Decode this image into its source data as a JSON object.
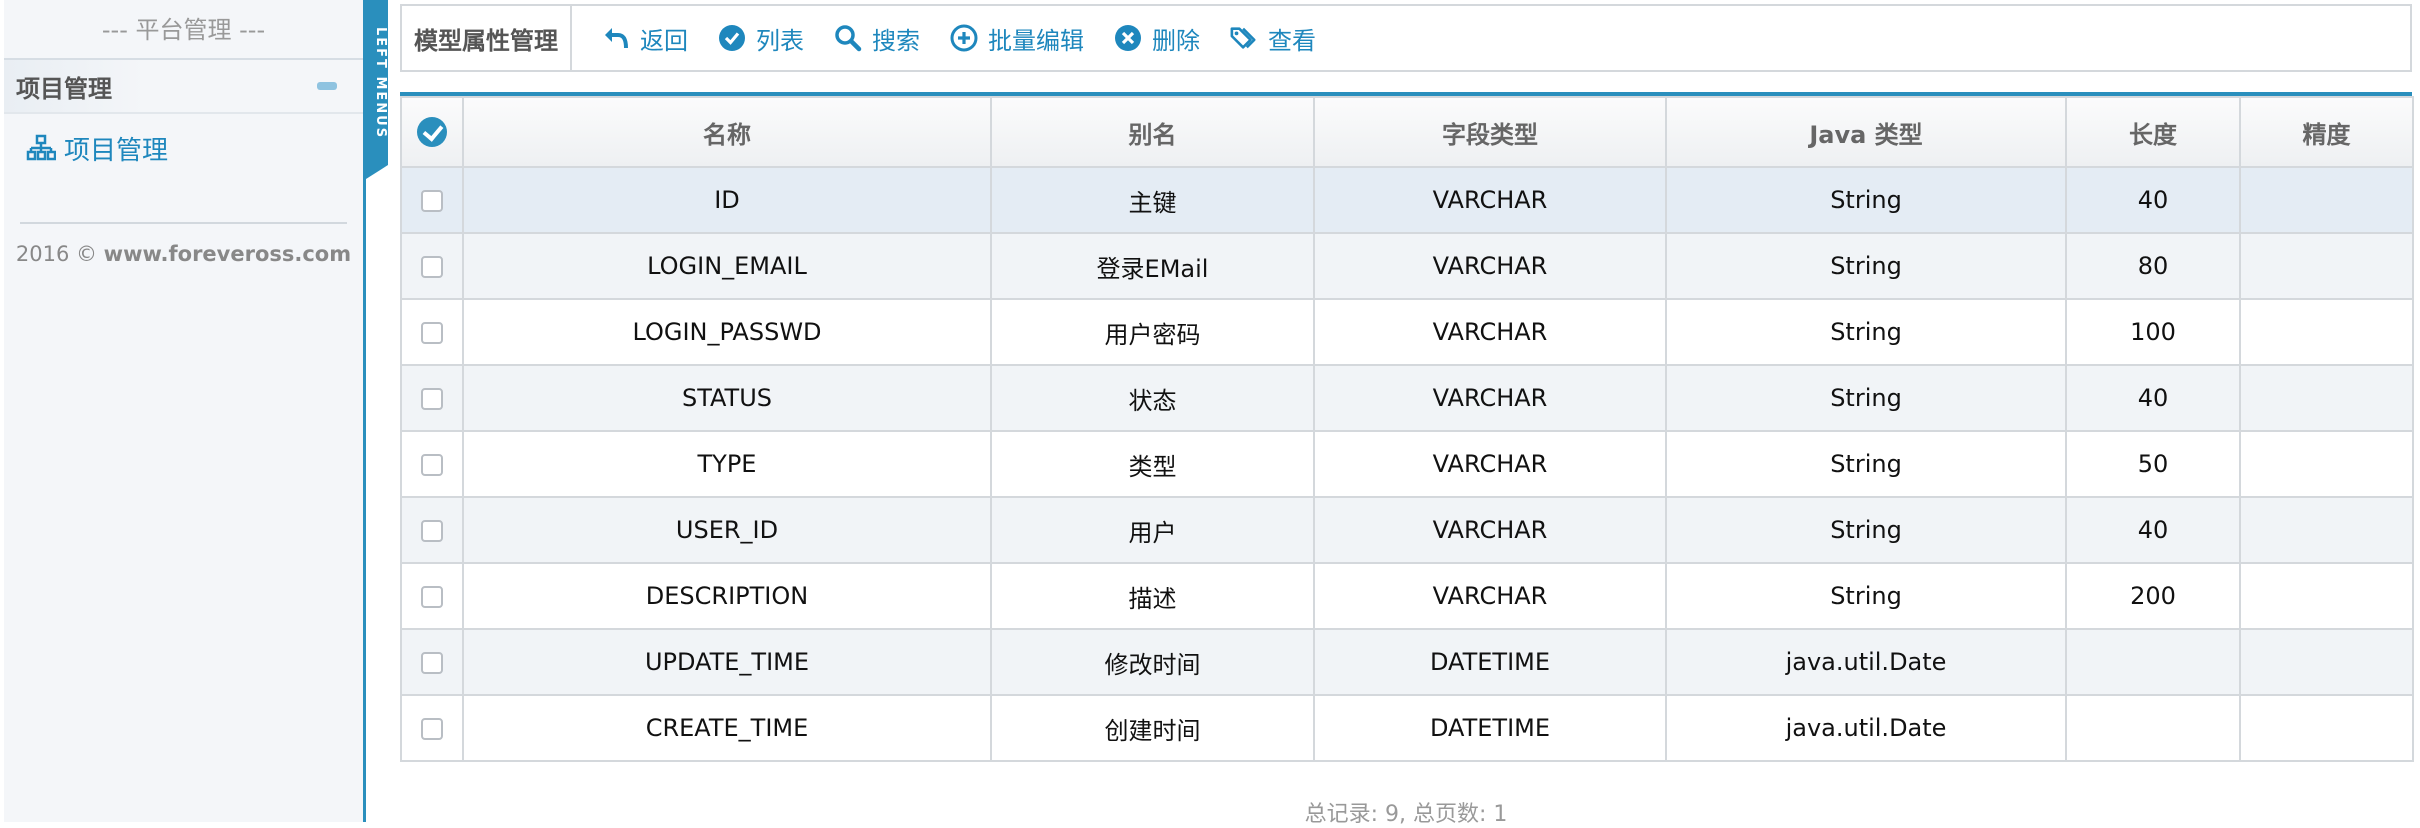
{
  "sidebar": {
    "title": "--- 平台管理 ---",
    "section_label": "项目管理",
    "items": [
      {
        "label": "项目管理",
        "icon": "sitemap-icon"
      }
    ],
    "copyright_prefix": "2016 © ",
    "copyright_site": "www.foreveross.com"
  },
  "left_tab": {
    "label": "LEFT MENUS"
  },
  "toolbar": {
    "title": "模型属性管理",
    "buttons": [
      {
        "label": "返回",
        "icon": "back-arrow-icon"
      },
      {
        "label": "列表",
        "icon": "check-circle-icon"
      },
      {
        "label": "搜索",
        "icon": "search-icon"
      },
      {
        "label": "批量编辑",
        "icon": "plus-circle-icon"
      },
      {
        "label": "删除",
        "icon": "x-circle-icon"
      },
      {
        "label": "查看",
        "icon": "tag-icon"
      }
    ]
  },
  "table": {
    "columns": [
      "名称",
      "别名",
      "字段类型",
      "Java 类型",
      "长度",
      "精度"
    ],
    "rows": [
      {
        "name": "ID",
        "alias": "主键",
        "field_type": "VARCHAR",
        "java_type": "String",
        "length": "40",
        "precision": ""
      },
      {
        "name": "LOGIN_EMAIL",
        "alias": "登录EMail",
        "field_type": "VARCHAR",
        "java_type": "String",
        "length": "80",
        "precision": ""
      },
      {
        "name": "LOGIN_PASSWD",
        "alias": "用户密码",
        "field_type": "VARCHAR",
        "java_type": "String",
        "length": "100",
        "precision": ""
      },
      {
        "name": "STATUS",
        "alias": "状态",
        "field_type": "VARCHAR",
        "java_type": "String",
        "length": "40",
        "precision": ""
      },
      {
        "name": "TYPE",
        "alias": "类型",
        "field_type": "VARCHAR",
        "java_type": "String",
        "length": "50",
        "precision": ""
      },
      {
        "name": "USER_ID",
        "alias": "用户",
        "field_type": "VARCHAR",
        "java_type": "String",
        "length": "40",
        "precision": ""
      },
      {
        "name": "DESCRIPTION",
        "alias": "描述",
        "field_type": "VARCHAR",
        "java_type": "String",
        "length": "200",
        "precision": ""
      },
      {
        "name": "UPDATE_TIME",
        "alias": "修改时间",
        "field_type": "DATETIME",
        "java_type": "java.util.Date",
        "length": "",
        "precision": ""
      },
      {
        "name": "CREATE_TIME",
        "alias": "创建时间",
        "field_type": "DATETIME",
        "java_type": "java.util.Date",
        "length": "",
        "precision": ""
      }
    ]
  },
  "pager": {
    "summary": "总记录: 9, 总页数: 1"
  },
  "colors": {
    "accent": "#2a8fbd",
    "link": "#1e87bd"
  }
}
